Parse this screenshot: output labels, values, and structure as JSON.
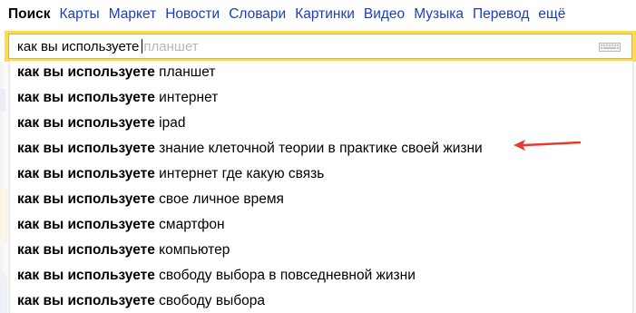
{
  "nav": {
    "items": [
      {
        "label": "Поиск",
        "active": true
      },
      {
        "label": "Карты",
        "active": false
      },
      {
        "label": "Маркет",
        "active": false
      },
      {
        "label": "Новости",
        "active": false
      },
      {
        "label": "Словари",
        "active": false
      },
      {
        "label": "Картинки",
        "active": false
      },
      {
        "label": "Видео",
        "active": false
      },
      {
        "label": "Музыка",
        "active": false
      },
      {
        "label": "Перевод",
        "active": false
      },
      {
        "label": "ещё",
        "active": false
      }
    ]
  },
  "search": {
    "query": "как вы используете",
    "hint": "планшет",
    "icon": "keyboard-icon"
  },
  "suggestions": {
    "prefix": "как вы используете",
    "items": [
      {
        "completion": "планшет"
      },
      {
        "completion": "интернет"
      },
      {
        "completion": "ipad"
      },
      {
        "completion": "знание клеточной теории в практике своей жизни"
      },
      {
        "completion": "интернет где какую связь"
      },
      {
        "completion": "свое личное время"
      },
      {
        "completion": "смартфон"
      },
      {
        "completion": "компьютер"
      },
      {
        "completion": "свободу выбора в повседневной жизни"
      },
      {
        "completion": "свободу выбора"
      }
    ]
  },
  "annotation": {
    "color": "#e53b2c",
    "target_index": 3
  },
  "colors": {
    "link": "#1a3dc1",
    "search_frame": "#ffdb4d",
    "hint": "#b7b7b7"
  }
}
